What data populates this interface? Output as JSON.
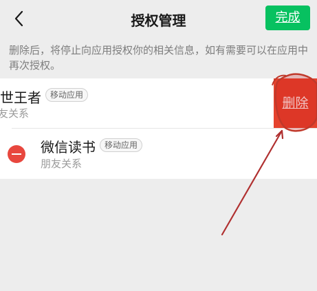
{
  "header": {
    "title": "授权管理",
    "done_label": "完成"
  },
  "notice": "删除后，将停止向应用授权你的相关信息，如有需要可以在应用中再次授权。",
  "apps": [
    {
      "name": "世王者",
      "badge": "移动应用",
      "sub": "友关系",
      "swiped": true
    },
    {
      "name": "微信读书",
      "badge": "移动应用",
      "sub": "朋友关系",
      "swiped": false
    }
  ],
  "actions": {
    "delete_label": "删除"
  },
  "colors": {
    "accent_green": "#07c160",
    "delete_red": "#e5432e",
    "annotation_red": "#c0392b"
  },
  "icons": {
    "back": "chevron-left-icon",
    "remove": "minus-circle-icon"
  }
}
